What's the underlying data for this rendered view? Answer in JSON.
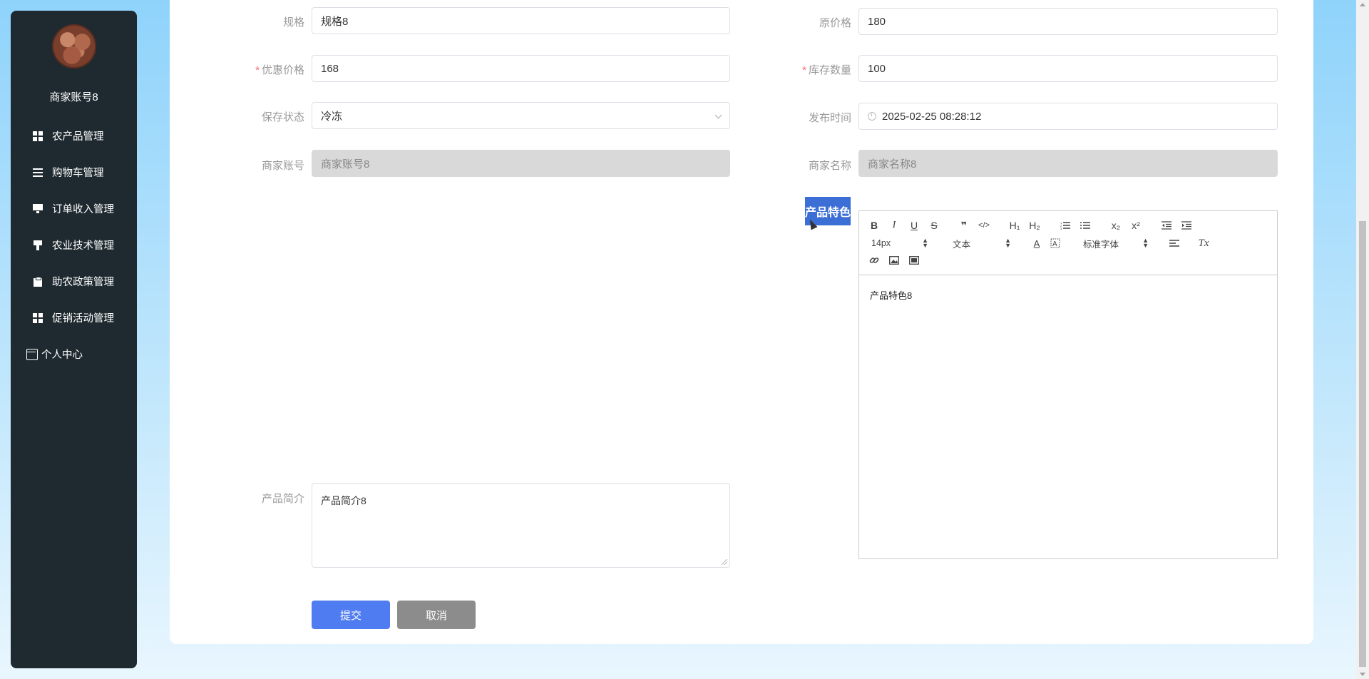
{
  "sidebar": {
    "username": "商家账号8",
    "items": [
      {
        "label": "农产品管理",
        "icon": "grid-icon"
      },
      {
        "label": "购物车管理",
        "icon": "list-icon"
      },
      {
        "label": "订单收入管理",
        "icon": "monitor-icon"
      },
      {
        "label": "农业技术管理",
        "icon": "brush-icon"
      },
      {
        "label": "助农政策管理",
        "icon": "clipboard-icon"
      },
      {
        "label": "促销活动管理",
        "icon": "grid-icon"
      }
    ],
    "personal": {
      "label": "个人中心",
      "icon": "card-icon"
    }
  },
  "form": {
    "spec": {
      "label": "规格",
      "value": "规格8"
    },
    "original_price": {
      "label": "原价格",
      "value": "180"
    },
    "discount_price": {
      "label": "优惠价格",
      "value": "168",
      "required": "*"
    },
    "stock": {
      "label": "库存数量",
      "value": "100",
      "required": "*"
    },
    "storage": {
      "label": "保存状态",
      "value": "冷冻"
    },
    "publish_time": {
      "label": "发布时间",
      "value": "2025-02-25 08:28:12"
    },
    "merchant_account": {
      "label": "商家账号",
      "placeholder": "商家账号8"
    },
    "merchant_name": {
      "label": "商家名称",
      "placeholder": "商家名称8"
    },
    "features": {
      "label": "产品特色",
      "content": "产品特色8"
    },
    "intro": {
      "label": "产品简介",
      "value": "产品简介8"
    }
  },
  "editor": {
    "font_size": "14px",
    "heading": "文本",
    "font_family": "标准字体",
    "buttons": {
      "bold": "B",
      "italic": "I",
      "underline": "U",
      "strike": "S",
      "quote": "❞",
      "code": "</>",
      "h1": "H₁",
      "h2": "H₂",
      "sub": "x₂",
      "sup": "x²",
      "color": "A",
      "clean": "Tx"
    }
  },
  "buttons": {
    "submit": "提交",
    "cancel": "取消"
  },
  "colors": {
    "primary": "#4f7cf0",
    "secondary": "#8c8c8c",
    "sidebar": "#1f2a30",
    "required": "#f56c6c"
  }
}
